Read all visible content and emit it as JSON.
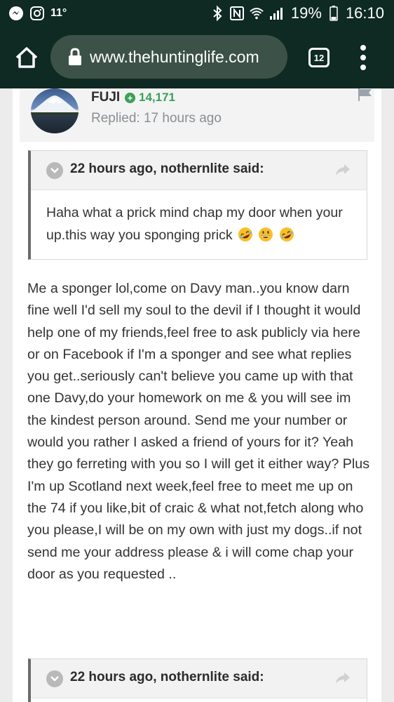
{
  "status_bar": {
    "temperature": "11°",
    "battery_percent": "19%",
    "time": "16:10",
    "icons": [
      "messenger-icon",
      "instagram-icon",
      "bluetooth-icon",
      "nfc-icon",
      "wifi-icon",
      "signal-icon",
      "battery-icon"
    ]
  },
  "browser": {
    "url": "www.thehuntinglife.com",
    "tab_count": "12"
  },
  "post": {
    "author": "FUJI",
    "reputation": "14,171",
    "replied": "Replied: 17 hours ago",
    "quote1": {
      "header": "22 hours ago, nothernlite said:",
      "text": "Haha what a prick mind chap my door when your up.this way you sponging prick",
      "emojis": [
        "rofl-emoji",
        "grin-emoji",
        "rofl-emoji"
      ]
    },
    "body": "Me a sponger lol,come on Davy man..you know darn fine well I'd sell my soul to the devil if I thought it would help one of my friends,feel free to ask publicly via here or on Facebook if I'm a sponger and see what replies you get..seriously can't believe you came up with that one Davy,do your homework on me & you will see im the kindest person around. Send me your number or would you rather I asked a friend of yours for it? Yeah they go ferreting with you so I will get it either way? Plus I'm up Scotland next week,feel free to meet me up on the 74 if you like,bit of craic & what not,fetch along who you please,I will be on my own with just my dogs..if not send me your address please & i will come chap your door as you requested ..",
    "quote2": {
      "header": "22 hours ago, nothernlite said:"
    }
  },
  "colors": {
    "toolbar_bg": "#0e2a22",
    "urlbar_bg": "#3c5249",
    "reputation_green": "#3aa05a",
    "quote_border": "#6b6b6b"
  }
}
